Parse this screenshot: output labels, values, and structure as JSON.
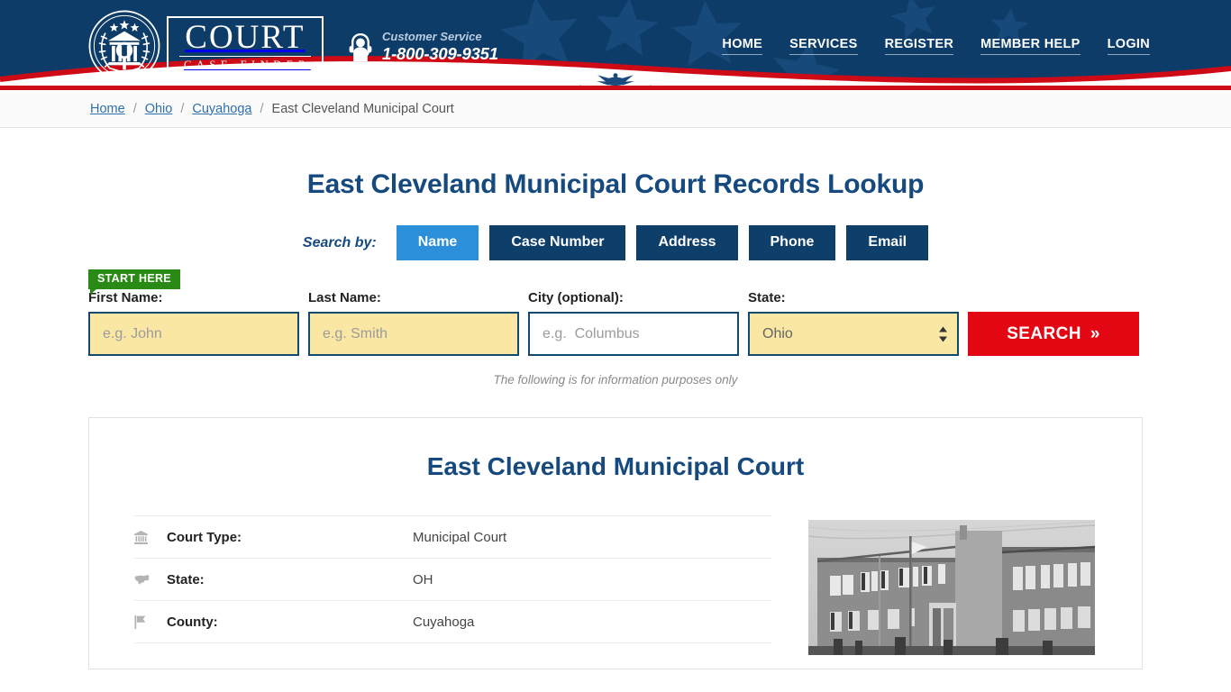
{
  "header": {
    "logo": {
      "seal_icon": "court-seal-icon",
      "primary": "COURT",
      "secondary": "CASE FINDER"
    },
    "customer_service": {
      "icon": "headset-support-icon",
      "label": "Customer Service",
      "phone": "1-800-309-9351"
    },
    "nav": [
      {
        "label": "HOME"
      },
      {
        "label": "SERVICES"
      },
      {
        "label": "REGISTER"
      },
      {
        "label": "MEMBER HELP"
      },
      {
        "label": "LOGIN"
      }
    ],
    "colors": {
      "navy": "#0d3c68",
      "red": "#cf0a17",
      "white": "#ffffff"
    }
  },
  "breadcrumb": {
    "separator": "/",
    "items": [
      {
        "label": "Home",
        "current": false
      },
      {
        "label": "Ohio",
        "current": false
      },
      {
        "label": "Cuyahoga",
        "current": false
      },
      {
        "label": "East Cleveland Municipal Court",
        "current": true
      }
    ]
  },
  "main": {
    "page_title": "East Cleveland Municipal Court Records Lookup",
    "search_by_label": "Search by:",
    "tabs": [
      {
        "label": "Name",
        "active": true
      },
      {
        "label": "Case Number",
        "active": false
      },
      {
        "label": "Address",
        "active": false
      },
      {
        "label": "Phone",
        "active": false
      },
      {
        "label": "Email",
        "active": false
      }
    ],
    "start_badge": "START HERE",
    "form": {
      "first_name": {
        "label": "First Name:",
        "placeholder": "e.g. John",
        "value": ""
      },
      "last_name": {
        "label": "Last Name:",
        "placeholder": "e.g. Smith",
        "value": ""
      },
      "city": {
        "label": "City (optional):",
        "placeholder": "e.g.  Columbus",
        "value": ""
      },
      "state": {
        "label": "State:",
        "value": "Ohio",
        "options": [
          "Ohio"
        ]
      },
      "search_button": "SEARCH",
      "search_button_glyph": "»"
    },
    "disclaimer": "The following is for information purposes only"
  },
  "court_card": {
    "title": "East Cleveland Municipal Court",
    "details": [
      {
        "icon": "bank-institution-icon",
        "key": "Court Type:",
        "value": "Municipal Court"
      },
      {
        "icon": "us-map-icon",
        "key": "State:",
        "value": "OH"
      },
      {
        "icon": "flag-icon",
        "key": "County:",
        "value": "Cuyahoga"
      }
    ],
    "photo": {
      "name": "courthouse-building-photo",
      "description": "Black and white photo of the East Cleveland Municipal Court building"
    }
  },
  "theme": {
    "accent_blue": "#2b8fd9",
    "tab_navy": "#0e3f6b",
    "title_blue": "#164a7f",
    "button_red": "#e30613",
    "field_yellow": "#fae7a4",
    "field_border": "#12496f",
    "badge_green": "#2a8a16"
  }
}
